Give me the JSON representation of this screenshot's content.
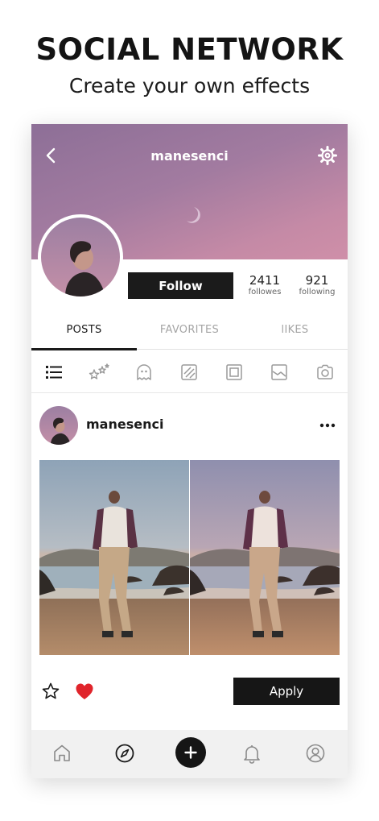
{
  "promo": {
    "title": "SOCIAL NETWORK",
    "subtitle": "Create your own effects"
  },
  "profile": {
    "username": "manesenci",
    "follow_label": "Follow",
    "followers_count": "2411",
    "followers_label": "followes",
    "following_count": "921",
    "following_label": "following"
  },
  "tabs": [
    {
      "label": "POSTS",
      "active": true
    },
    {
      "label": "FAVORITES",
      "active": false
    },
    {
      "label": "lIKES",
      "active": false
    }
  ],
  "filter_icons": [
    "list-icon",
    "sparkles-icon",
    "ghost-icon",
    "pattern-icon",
    "frame-icon",
    "landscape-icon",
    "camera-icon"
  ],
  "post": {
    "username": "manesenci",
    "apply_label": "Apply",
    "liked": true
  },
  "bottom_nav": [
    "home-icon",
    "compass-icon",
    "add-icon",
    "bell-icon",
    "user-icon"
  ],
  "colors": {
    "accent": "#1b1b1b",
    "cover_top": "#8d6f97",
    "cover_bottom": "#cf8fa8",
    "heart": "#e0242b"
  }
}
